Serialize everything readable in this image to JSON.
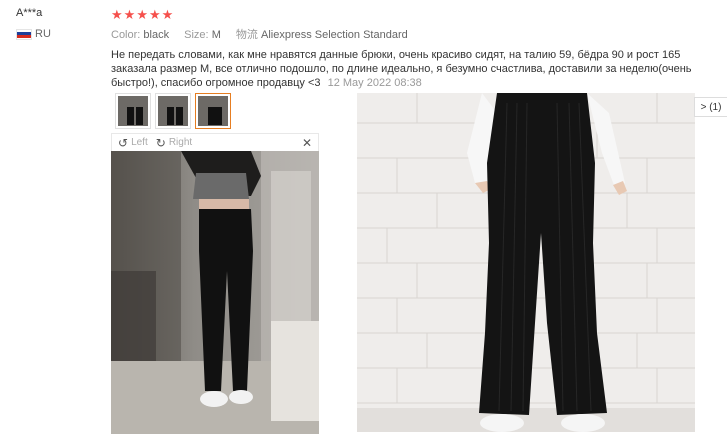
{
  "reviewer": {
    "name": "A***a",
    "country": "RU"
  },
  "review": {
    "rating": 5,
    "stars": [
      "★",
      "★",
      "★",
      "★",
      "★"
    ],
    "color_label": "Color:",
    "color_value": "black",
    "size_label": "Size:",
    "size_value": "M",
    "shipping_label": "物流",
    "shipping_value": "Aliexpress Selection Standard",
    "text": "Не передать словами, как мне нравятся данные брюки, очень красиво сидят, на талию 59, бёдра 90 и рост 165 заказала размер М, все отлично подошло, по длине идеально, я безумно счастлива, доставили за неделю(очень быстро!), спасибо огромное продавцу <3",
    "date": "12 May 2022 08:38"
  },
  "viewer": {
    "rotate_left_label": "Left",
    "rotate_right_label": "Right",
    "close_glyph": "✕"
  },
  "side_chip": {
    "label": "> (1)"
  },
  "colors": {
    "star": "#f5504c",
    "active_thumb_border": "#e67e22"
  }
}
